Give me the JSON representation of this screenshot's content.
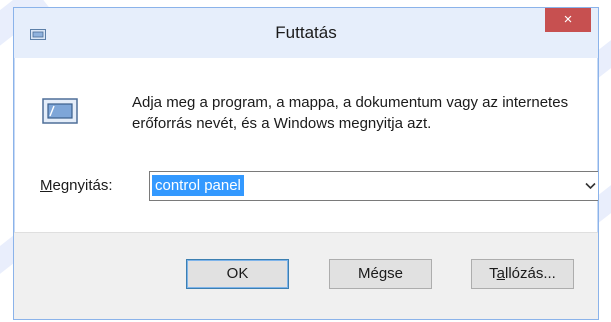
{
  "window": {
    "title": "Futtatás",
    "close_glyph": "×",
    "accent_color": "#c75050",
    "titlebar_color": "#e6eefb"
  },
  "icons": {
    "title": "run-dialog-icon",
    "main": "run-dialog-icon",
    "close": "close-icon",
    "dropdown": "chevron-down-icon"
  },
  "main": {
    "description": "Adja meg a program, a mappa, a dokumentum vagy az internetes erőforrás nevét, és a Windows megnyitja azt.",
    "open_label_prefix": "M",
    "open_label_rest": "egnyitás:",
    "input_value": "control panel",
    "dropdown_glyph": "⌄"
  },
  "buttons": {
    "ok": "OK",
    "cancel": "Mégse",
    "browse_prefix": "T",
    "browse_underlined": "a",
    "browse_rest": "llózás..."
  }
}
